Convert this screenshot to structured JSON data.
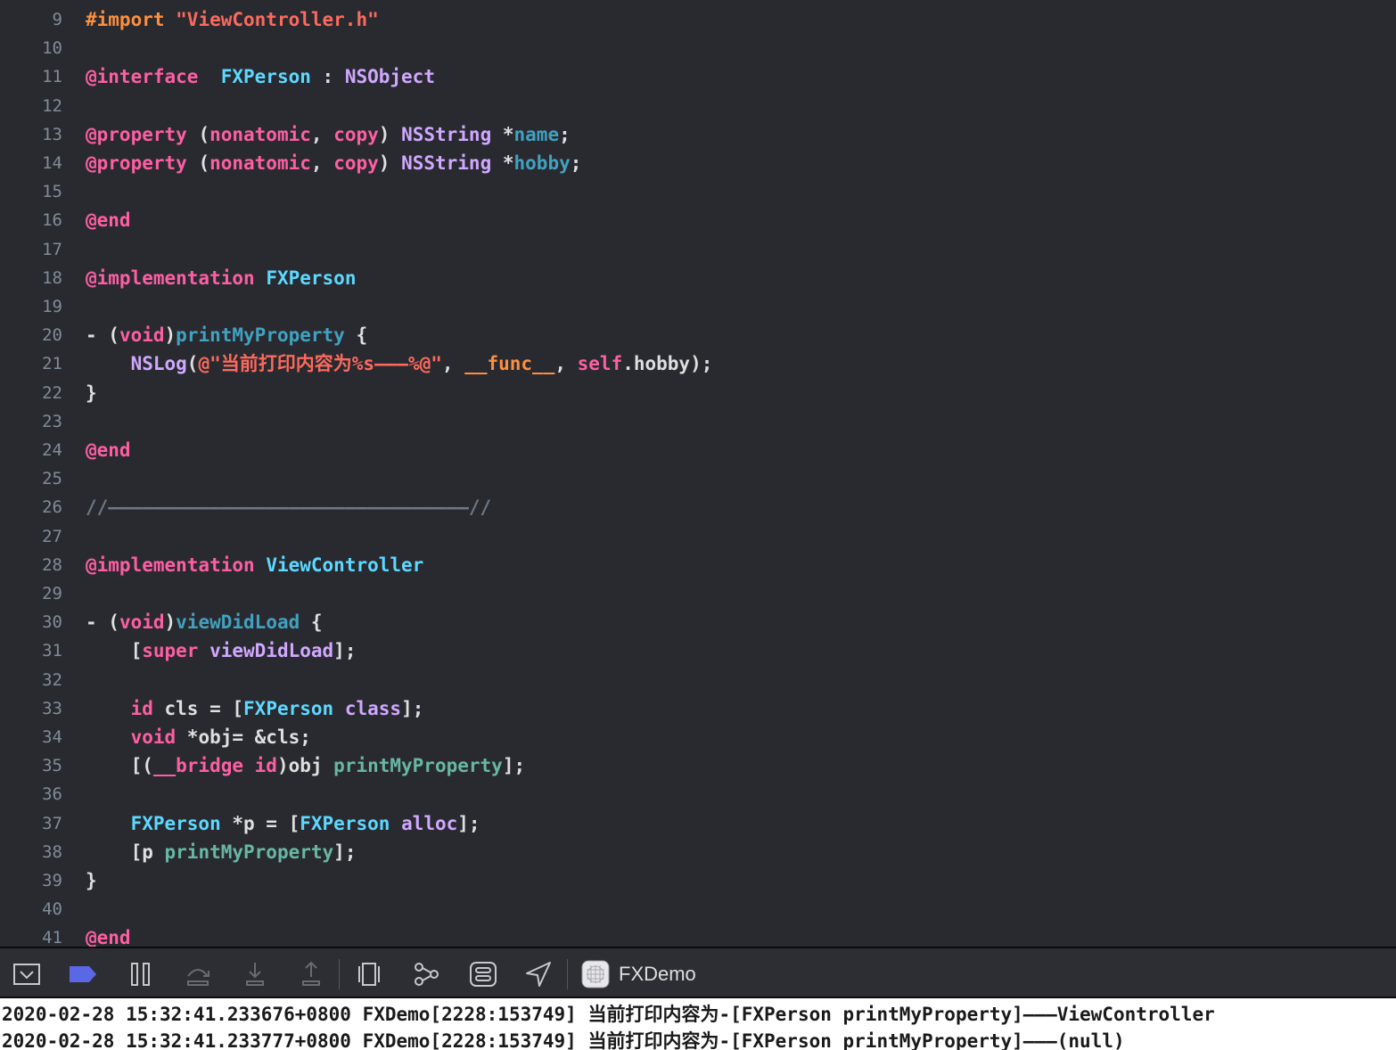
{
  "editor": {
    "lines": [
      {
        "n": "9",
        "t": [
          [
            "pre",
            "#import "
          ],
          [
            "str",
            "\"ViewController.h\""
          ]
        ]
      },
      {
        "n": "10",
        "t": []
      },
      {
        "n": "11",
        "t": [
          [
            "kw",
            "@interface"
          ],
          [
            "",
            "  "
          ],
          [
            "cls",
            "FXPerson"
          ],
          [
            "",
            " : "
          ],
          [
            "lib",
            "NSObject"
          ]
        ]
      },
      {
        "n": "12",
        "t": []
      },
      {
        "n": "13",
        "t": [
          [
            "kw",
            "@property"
          ],
          [
            "",
            " ("
          ],
          [
            "kw",
            "nonatomic"
          ],
          [
            ", "
          ],
          [
            "kw",
            "copy"
          ],
          [
            ") "
          ],
          [
            "lib",
            "NSString"
          ],
          [
            "",
            " *"
          ],
          [
            "prop",
            "name"
          ],
          [
            "",
            ";"
          ]
        ]
      },
      {
        "n": "14",
        "t": [
          [
            "kw",
            "@property"
          ],
          [
            "",
            " ("
          ],
          [
            "kw",
            "nonatomic"
          ],
          [
            ", "
          ],
          [
            "kw",
            "copy"
          ],
          [
            ") "
          ],
          [
            "lib",
            "NSString"
          ],
          [
            "",
            " *"
          ],
          [
            "prop",
            "hobby"
          ],
          [
            "",
            ";"
          ]
        ]
      },
      {
        "n": "15",
        "t": []
      },
      {
        "n": "16",
        "t": [
          [
            "kw",
            "@end"
          ]
        ]
      },
      {
        "n": "17",
        "t": []
      },
      {
        "n": "18",
        "t": [
          [
            "kw",
            "@implementation"
          ],
          [
            "",
            " "
          ],
          [
            "cls",
            "FXPerson"
          ]
        ]
      },
      {
        "n": "19",
        "t": []
      },
      {
        "n": "20",
        "t": [
          [
            "",
            "- ("
          ],
          [
            "kw",
            "void"
          ],
          [
            "",
            ")"
          ],
          [
            "prop",
            "printMyProperty"
          ],
          [
            "",
            " {"
          ]
        ]
      },
      {
        "n": "21",
        "t": [
          [
            "",
            "    "
          ],
          [
            "lib",
            "NSLog"
          ],
          [
            "",
            "("
          ],
          [
            "str",
            "@\"当前打印内容为%s———%@\""
          ],
          [
            "",
            ", "
          ],
          [
            "macro",
            "__func__"
          ],
          [
            "",
            ", "
          ],
          [
            "kw",
            "self"
          ],
          [
            "",
            ".hobby);"
          ]
        ]
      },
      {
        "n": "22",
        "t": [
          [
            "",
            "}"
          ]
        ]
      },
      {
        "n": "23",
        "t": []
      },
      {
        "n": "24",
        "t": [
          [
            "kw",
            "@end"
          ]
        ]
      },
      {
        "n": "25",
        "t": []
      },
      {
        "n": "26",
        "t": [
          [
            "cmt",
            "//————————————————————————————————//"
          ]
        ]
      },
      {
        "n": "27",
        "t": []
      },
      {
        "n": "28",
        "t": [
          [
            "kw",
            "@implementation"
          ],
          [
            "",
            " "
          ],
          [
            "cls",
            "ViewController"
          ]
        ]
      },
      {
        "n": "29",
        "t": []
      },
      {
        "n": "30",
        "t": [
          [
            "",
            "- ("
          ],
          [
            "kw",
            "void"
          ],
          [
            "",
            ")"
          ],
          [
            "prop",
            "viewDidLoad"
          ],
          [
            "",
            " {"
          ]
        ]
      },
      {
        "n": "31",
        "t": [
          [
            "",
            "    ["
          ],
          [
            "kw",
            "super"
          ],
          [
            "",
            " "
          ],
          [
            "lib",
            "viewDidLoad"
          ],
          [
            "",
            "];"
          ]
        ]
      },
      {
        "n": "32",
        "t": []
      },
      {
        "n": "33",
        "t": [
          [
            "",
            "    "
          ],
          [
            "kw",
            "id"
          ],
          [
            "",
            " cls = ["
          ],
          [
            "cls",
            "FXPerson"
          ],
          [
            "",
            " "
          ],
          [
            "lib",
            "class"
          ],
          [
            "",
            "];"
          ]
        ]
      },
      {
        "n": "34",
        "t": [
          [
            "",
            "    "
          ],
          [
            "kw",
            "void"
          ],
          [
            "",
            " *obj= &cls;"
          ]
        ]
      },
      {
        "n": "35",
        "t": [
          [
            "",
            "    [("
          ],
          [
            "kw",
            "__bridge id"
          ],
          [
            "",
            ")obj "
          ],
          [
            "fn",
            "printMyProperty"
          ],
          [
            "",
            "];"
          ]
        ]
      },
      {
        "n": "36",
        "t": []
      },
      {
        "n": "37",
        "t": [
          [
            "",
            "    "
          ],
          [
            "cls",
            "FXPerson"
          ],
          [
            "",
            " *p = ["
          ],
          [
            "cls",
            "FXPerson"
          ],
          [
            "",
            " "
          ],
          [
            "lib",
            "alloc"
          ],
          [
            "",
            "];"
          ]
        ]
      },
      {
        "n": "38",
        "t": [
          [
            "",
            "    [p "
          ],
          [
            "fn",
            "printMyProperty"
          ],
          [
            "",
            "];"
          ]
        ]
      },
      {
        "n": "39",
        "t": [
          [
            "",
            "}"
          ]
        ]
      },
      {
        "n": "40",
        "t": []
      },
      {
        "n": "41",
        "t": [
          [
            "kw",
            "@end"
          ]
        ]
      }
    ]
  },
  "toolbar": {
    "buttons": [
      {
        "name": "hide-debug-area-icon",
        "interactable": true
      },
      {
        "name": "breakpoints-toggle-icon",
        "interactable": true
      },
      {
        "name": "pause-icon",
        "interactable": true
      },
      {
        "name": "step-over-icon",
        "interactable": true
      },
      {
        "name": "step-into-icon",
        "interactable": true
      },
      {
        "name": "step-out-icon",
        "interactable": true
      },
      {
        "name": "debug-view-hierarchy-icon",
        "interactable": true
      },
      {
        "name": "memory-graph-icon",
        "interactable": true
      },
      {
        "name": "environment-overrides-icon",
        "interactable": true
      },
      {
        "name": "simulate-location-icon",
        "interactable": true
      }
    ],
    "scheme_name": "FXDemo",
    "accent_color": "#5b68e6"
  },
  "console": {
    "lines": [
      "2020-02-28 15:32:41.233676+0800 FXDemo[2228:153749] 当前打印内容为-[FXPerson printMyProperty]———ViewController",
      "2020-02-28 15:32:41.233777+0800 FXDemo[2228:153749] 当前打印内容为-[FXPerson printMyProperty]———(null)"
    ]
  }
}
